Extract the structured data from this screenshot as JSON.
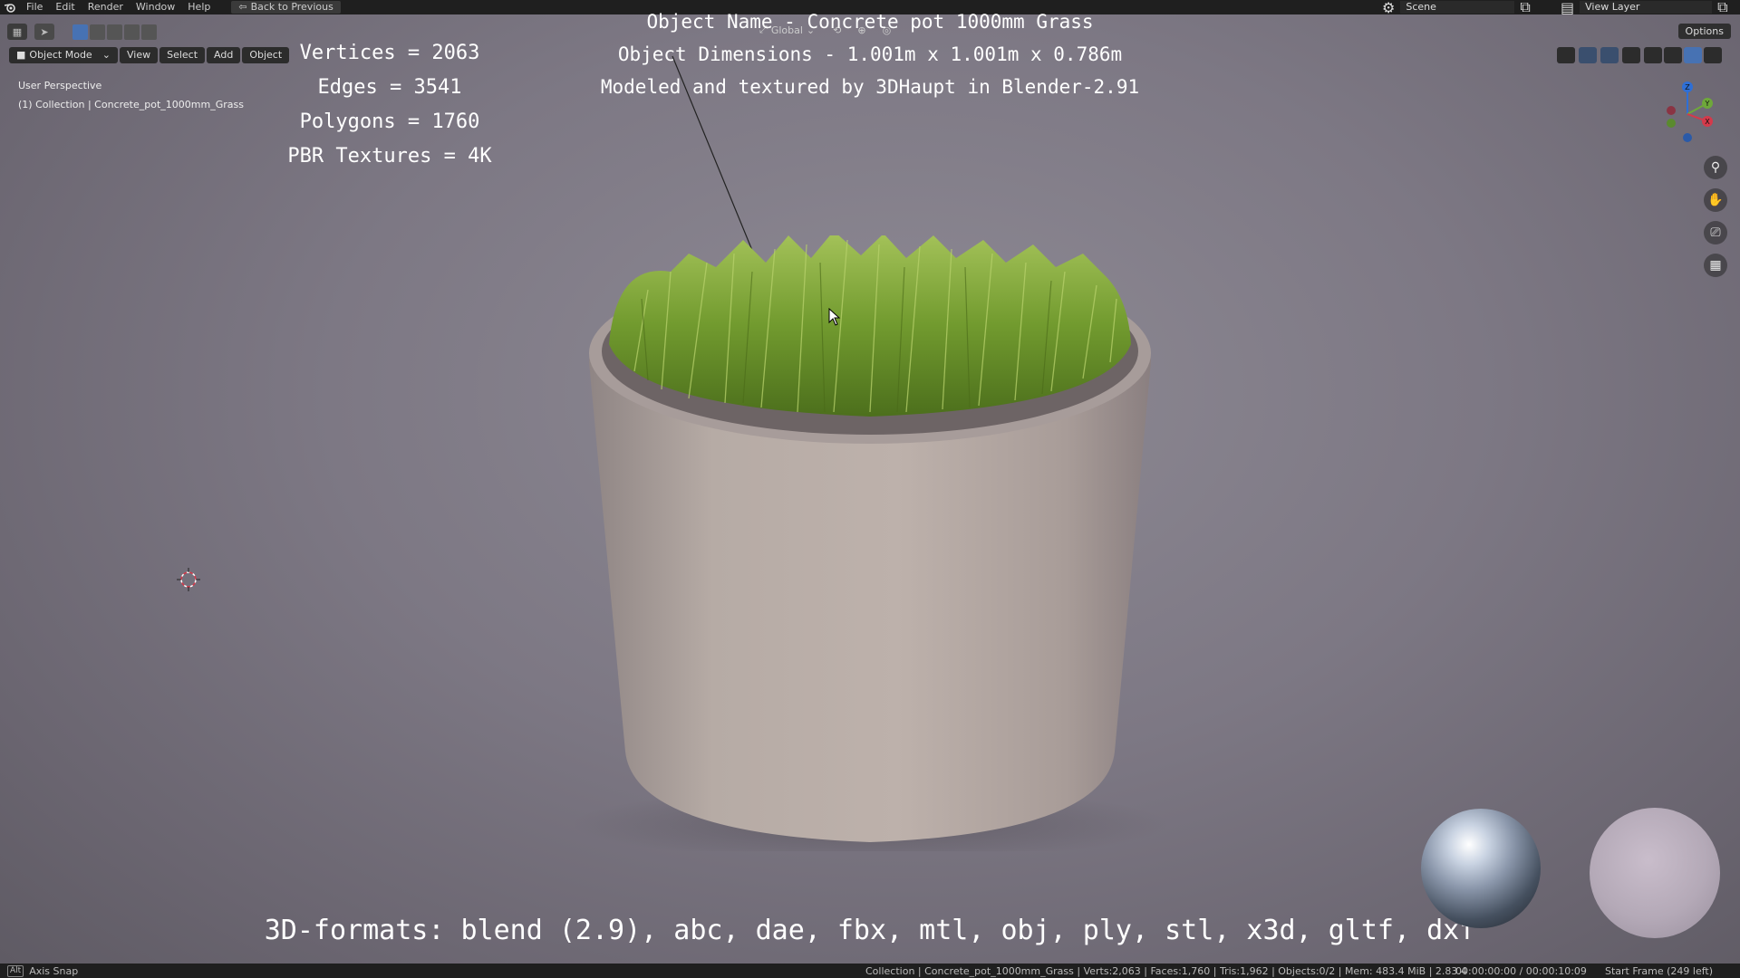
{
  "menubar": {
    "items": [
      "File",
      "Edit",
      "Render",
      "Window",
      "Help"
    ],
    "back_button": "Back to Previous",
    "scene": "Scene",
    "view_layer": "View Layer"
  },
  "viewport_header": {
    "mode": "Object Mode",
    "menus": [
      "View",
      "Select",
      "Add",
      "Object"
    ],
    "transform_orientation": "Global",
    "options": "Options"
  },
  "viewport_info": {
    "perspective": "User Perspective",
    "collection": "(1) Collection | Concrete_pot_1000mm_Grass"
  },
  "overlay_text": {
    "object_name": "Object Name - Concrete pot 1000mm Grass",
    "dimensions": "Object Dimensions -  1.001m x 1.001m x 0.786m",
    "credits": "Modeled and textured by 3DHaupt in Blender-2.91",
    "vertices": "Vertices = 2063",
    "edges": "Edges = 3541",
    "polygons": "Polygons = 1760",
    "textures": "PBR Textures = 4K",
    "formats": "3D-formats: blend (2.9), abc, dae, fbx, mtl, obj, ply, stl, x3d, gltf, dxf"
  },
  "gizmo_axes": {
    "z": "Z",
    "y": "Y",
    "x": "X"
  },
  "statusbar": {
    "key": "Alt",
    "hint": "Axis Snap",
    "stats": "Collection | Concrete_pot_1000mm_Grass | Verts:2,063 | Faces:1,760 | Tris:1,962 | Objects:0/2 | Mem: 483.4 MiB | 2.83.4",
    "time": "00:00:00:00 / 00:00:10:09",
    "frame": "Start Frame (249 left)"
  },
  "colors": {
    "accent": "#4772b3",
    "grass": "#6f9a2c",
    "concrete": "#b9aca6"
  }
}
